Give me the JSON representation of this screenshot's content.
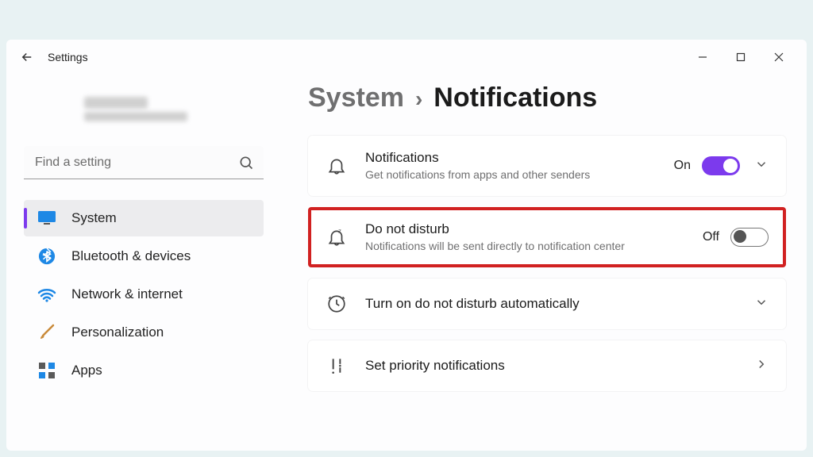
{
  "window": {
    "title": "Settings"
  },
  "search": {
    "placeholder": "Find a setting"
  },
  "nav": {
    "items": [
      {
        "label": "System"
      },
      {
        "label": "Bluetooth & devices"
      },
      {
        "label": "Network & internet"
      },
      {
        "label": "Personalization"
      },
      {
        "label": "Apps"
      }
    ]
  },
  "breadcrumb": {
    "parent": "System",
    "sep": "›",
    "current": "Notifications"
  },
  "cards": {
    "notifications": {
      "title": "Notifications",
      "desc": "Get notifications from apps and other senders",
      "state": "On"
    },
    "dnd": {
      "title": "Do not disturb",
      "desc": "Notifications will be sent directly to notification center",
      "state": "Off"
    },
    "auto": {
      "title": "Turn on do not disturb automatically"
    },
    "priority": {
      "title": "Set priority notifications"
    }
  }
}
